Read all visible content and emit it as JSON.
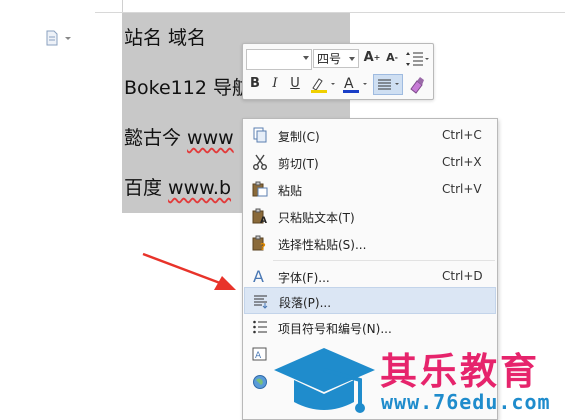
{
  "document": {
    "lines": [
      {
        "prefix": "站名 域名",
        "rest": ""
      },
      {
        "prefix": "Boke112 导航",
        "rest": ""
      },
      {
        "prefix": "懿古今 ",
        "rest": "www"
      },
      {
        "prefix": "百度 ",
        "rest": "www.b"
      }
    ]
  },
  "mini_toolbar": {
    "font_name": "",
    "font_size": "四号",
    "grow_font": "A",
    "shrink_font": "A",
    "bold": "B",
    "italic": "I",
    "underline": "U",
    "font_color_glyph": "A",
    "highlight_color": "#f0d000",
    "font_color": "#1a3fc7"
  },
  "context_menu": {
    "items": [
      {
        "label": "复制(C)",
        "shortcut": "Ctrl+C",
        "icon": "copy-icon"
      },
      {
        "label": "剪切(T)",
        "shortcut": "Ctrl+X",
        "icon": "scissors-icon"
      },
      {
        "label": "粘贴",
        "shortcut": "Ctrl+V",
        "icon": "paste-icon"
      },
      {
        "label": "只粘贴文本(T)",
        "shortcut": "",
        "icon": "paste-text-icon"
      },
      {
        "label": "选择性粘贴(S)...",
        "shortcut": "",
        "icon": "paste-special-icon"
      },
      {
        "label": "字体(F)...",
        "shortcut": "Ctrl+D",
        "icon": "font-icon"
      },
      {
        "label": "段落(P)...",
        "shortcut": "",
        "icon": "paragraph-icon",
        "highlighted": true
      },
      {
        "label": "项目符号和编号(N)...",
        "shortcut": "",
        "icon": "bullets-icon"
      }
    ]
  },
  "watermark": {
    "brand": "其乐教育",
    "url": "www.76edu.com",
    "brand_color": "#e6246c",
    "url_color": "#1f8ccc"
  }
}
